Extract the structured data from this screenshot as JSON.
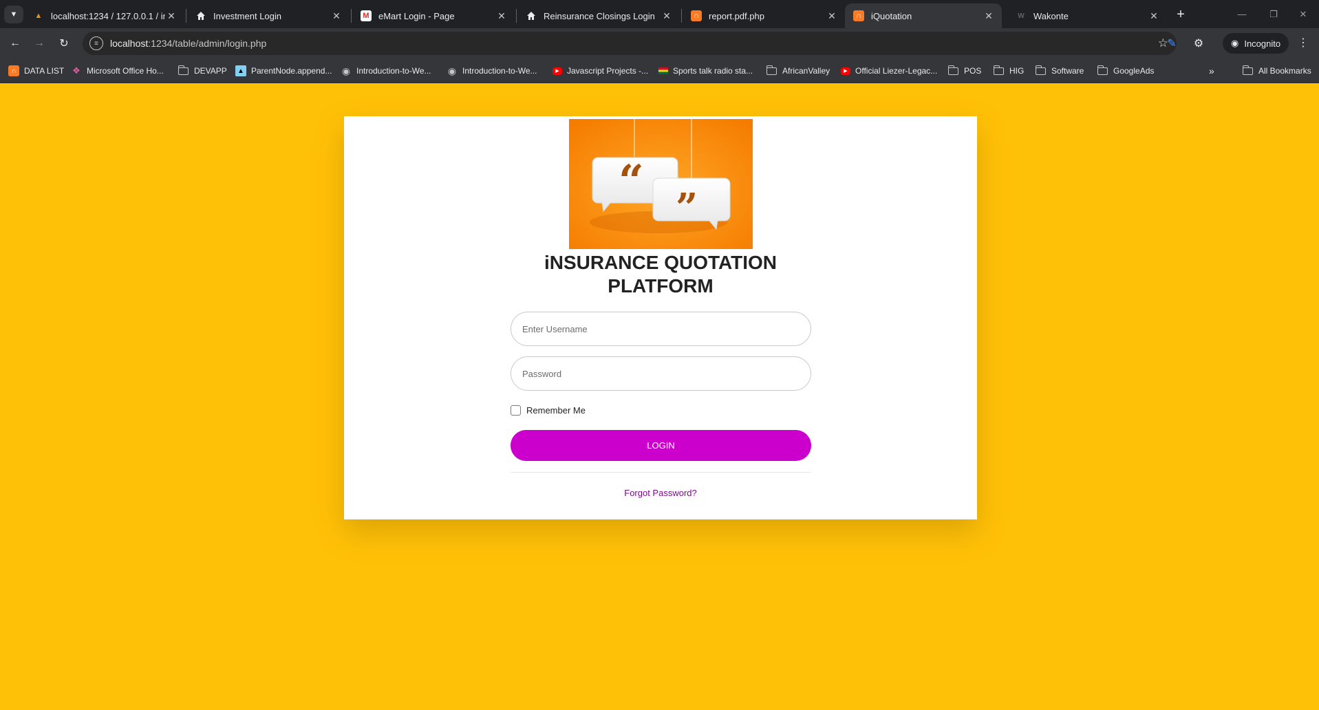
{
  "browser": {
    "tabs": [
      {
        "title": "localhost:1234 / 127.0.0.1 / inve",
        "icon": "phpmyadmin-icon",
        "active": false
      },
      {
        "title": "Investment Login",
        "icon": "home-icon",
        "active": false
      },
      {
        "title": "eMart Login - Page",
        "icon": "emart-icon",
        "active": false
      },
      {
        "title": "Reinsurance Closings Login",
        "icon": "home-icon",
        "active": false
      },
      {
        "title": "report.pdf.php",
        "icon": "xampp-icon",
        "active": false
      },
      {
        "title": "iQuotation",
        "icon": "xampp-icon",
        "active": true
      },
      {
        "title": "Wakonte",
        "icon": "wakonte-icon",
        "active": false
      }
    ],
    "address": {
      "host": "localhost",
      "path": ":1234/table/admin/login.php"
    },
    "incognito_label": "Incognito",
    "bookmarks": [
      {
        "label": "DATA LIST",
        "icon": "xampp-icon"
      },
      {
        "label": "Microsoft Office Ho...",
        "icon": "office-icon"
      },
      {
        "label": "DEVAPP",
        "icon": "folder-icon"
      },
      {
        "label": "ParentNode.append...",
        "icon": "mdn-icon"
      },
      {
        "label": "Introduction-to-We...",
        "icon": "github-icon"
      },
      {
        "label": "Introduction-to-We...",
        "icon": "github-icon"
      },
      {
        "label": "Javascript Projects -...",
        "icon": "youtube-icon"
      },
      {
        "label": "Sports talk radio sta...",
        "icon": "ghana-flag-icon"
      },
      {
        "label": "AfricanValley",
        "icon": "folder-icon"
      },
      {
        "label": "Official Liezer-Legac...",
        "icon": "youtube-icon"
      },
      {
        "label": "POS",
        "icon": "folder-icon"
      },
      {
        "label": "HIG",
        "icon": "folder-icon"
      },
      {
        "label": "Software",
        "icon": "folder-icon"
      },
      {
        "label": "GoogleAds",
        "icon": "folder-icon"
      }
    ],
    "all_bookmarks_label": "All Bookmarks"
  },
  "login": {
    "title_line1": "iNSURANCE QUOTATION",
    "title_line2": "PLATFORM",
    "username_placeholder": "Enter Username",
    "password_placeholder": "Password",
    "remember_label": "Remember Me",
    "login_label": "LOGIN",
    "forgot_label": "Forgot Password?"
  },
  "colors": {
    "page_background": "#ffc107",
    "login_button": "#cc00cc",
    "forgot_link": "#7a0a8a",
    "hero_orange": "#ff9800"
  }
}
